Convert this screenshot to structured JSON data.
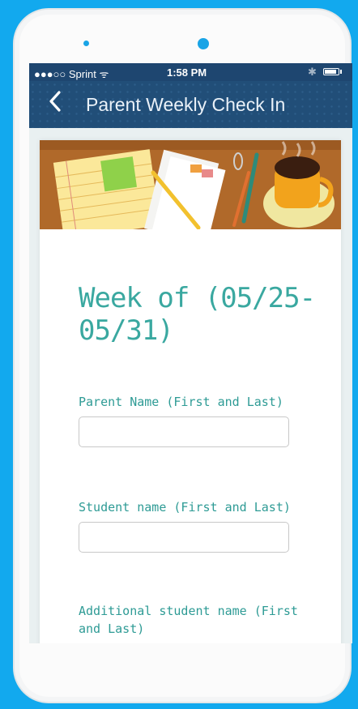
{
  "status_bar": {
    "carrier": "●●●○○ Sprint ᯤ",
    "time": "1:58 PM",
    "bluetooth": "✱",
    "battery_icon": "battery-icon"
  },
  "nav": {
    "back_icon": "chevron-left-icon",
    "title": "Parent Weekly Check In"
  },
  "form": {
    "title": "Week of (05/25-05/31)",
    "fields": [
      {
        "label": "Parent Name (First and Last)",
        "value": "",
        "placeholder": ""
      },
      {
        "label": "Student name (First and Last)",
        "value": "",
        "placeholder": ""
      },
      {
        "label": "Additional student name (First and Last)",
        "value": "",
        "placeholder": ""
      }
    ]
  },
  "colors": {
    "background": "#12a9ee",
    "nav_bar": "#214e78",
    "accent_text": "#3aa8a0"
  }
}
